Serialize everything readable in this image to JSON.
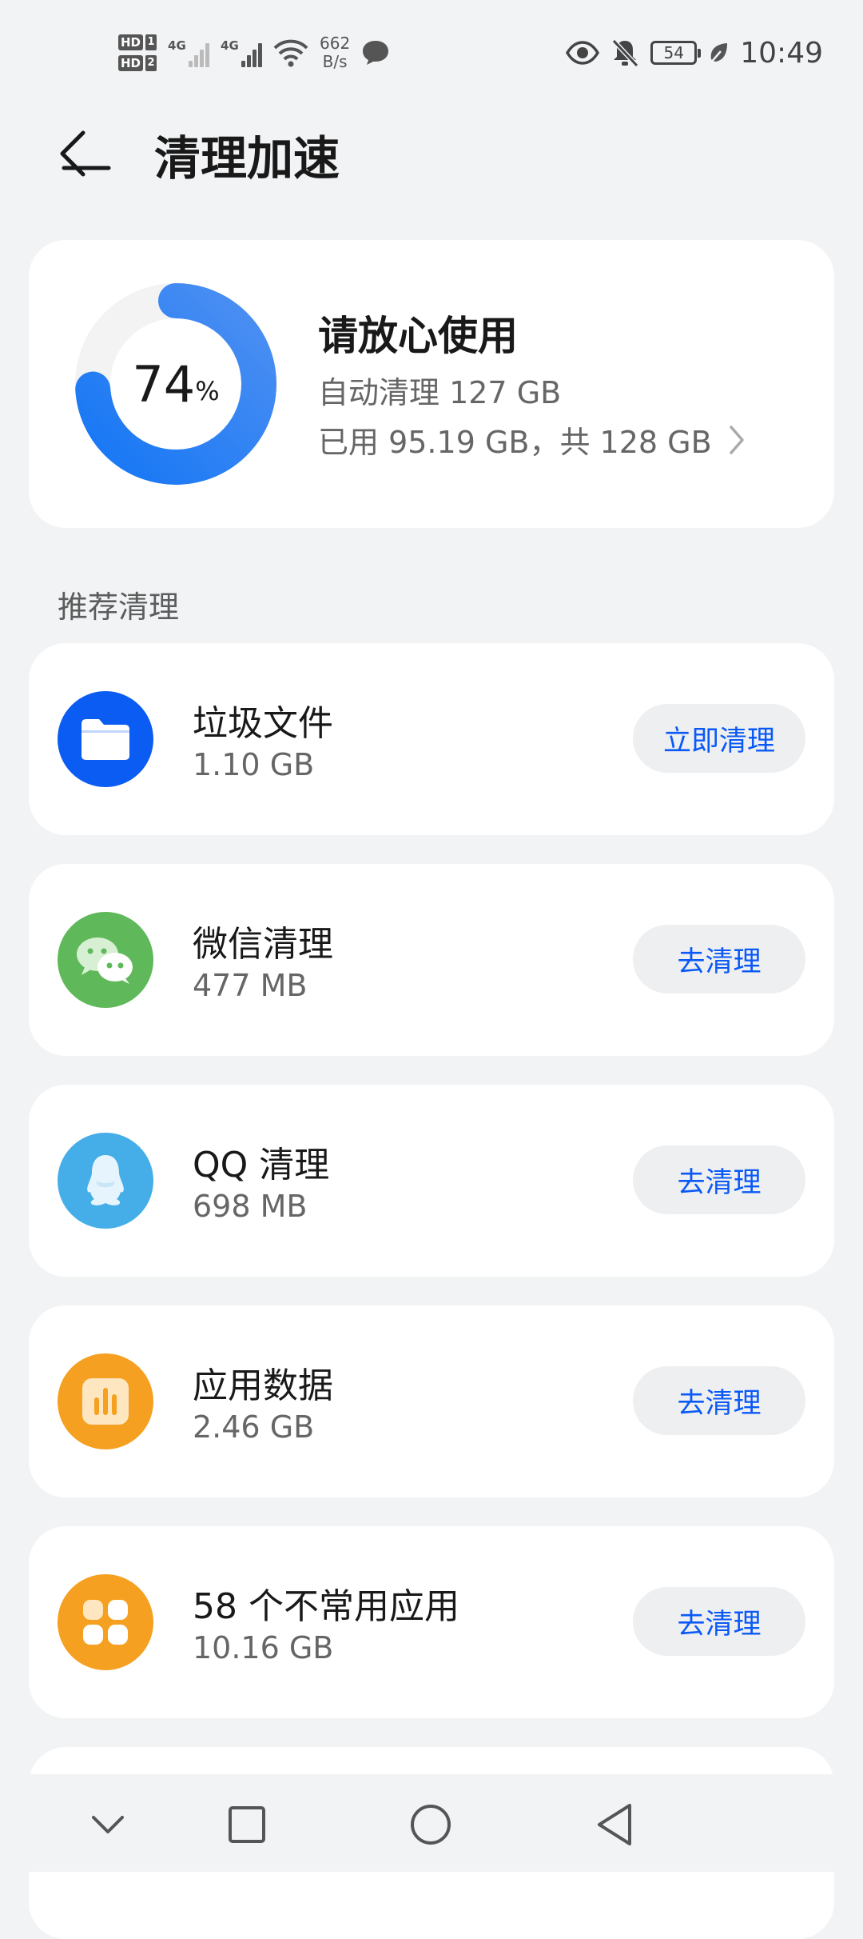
{
  "status_bar": {
    "sim1": "HD",
    "sim1_num": "1",
    "sim2": "HD",
    "sim2_num": "2",
    "net1": "4G",
    "net2": "4G",
    "net_speed_value": "662",
    "net_speed_unit": "B/s",
    "battery": "54",
    "time": "10:49"
  },
  "header": {
    "title": "清理加速"
  },
  "storage": {
    "percent": "74",
    "percent_unit": "%",
    "percent_value": 74,
    "status": "请放心使用",
    "auto_clean": "自动清理 127 GB",
    "used_total": "已用 95.19 GB，共 128 GB",
    "ring_color_start": "#2f7df6",
    "ring_color_end": "#1a6ff0",
    "ring_track": "#f3f3f3"
  },
  "recommend": {
    "section_title": "推荐清理",
    "items": [
      {
        "name": "垃圾文件",
        "size": "1.10 GB",
        "action": "立即清理",
        "icon": "folder-icon",
        "color": "#0b5cf2"
      },
      {
        "name": "微信清理",
        "size": "477 MB",
        "action": "去清理",
        "icon": "wechat-icon",
        "color": "#5fb95a"
      },
      {
        "name": "QQ 清理",
        "size": "698 MB",
        "action": "去清理",
        "icon": "qq-penguin-icon",
        "color": "#45aee8"
      },
      {
        "name": "应用数据",
        "size": "2.46 GB",
        "action": "去清理",
        "icon": "bar-chart-icon",
        "color": "#f5a020"
      },
      {
        "name": "58 个不常用应用",
        "size": "10.16 GB",
        "action": "去清理",
        "icon": "apps-grid-icon",
        "color": "#f5a020"
      }
    ]
  },
  "accent": "#0a59f7"
}
